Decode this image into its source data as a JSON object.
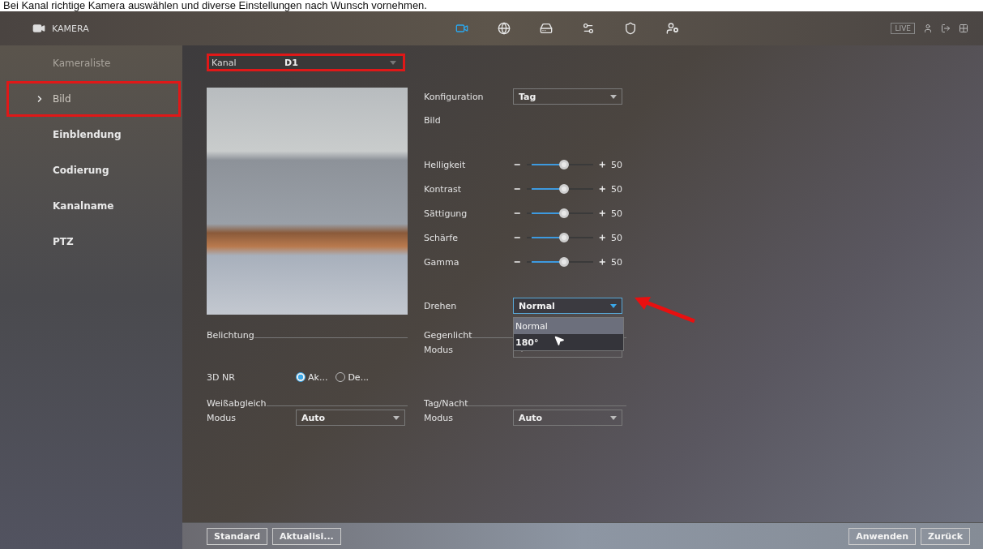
{
  "caption": "Bei Kanal richtige Kamera auswählen und diverse Einstellungen nach Wunsch vornehmen.",
  "topbar": {
    "title": "KAMERA",
    "live": "LIVE",
    "nav": [
      {
        "kind": "camera",
        "selected": true
      },
      {
        "kind": "network",
        "selected": false
      },
      {
        "kind": "storage",
        "selected": false
      },
      {
        "kind": "system",
        "selected": false
      },
      {
        "kind": "security",
        "selected": false
      },
      {
        "kind": "account",
        "selected": false
      }
    ]
  },
  "sidebar": {
    "items": [
      {
        "label": "Kameraliste",
        "kind": "heading",
        "selected": false,
        "highlighted": false
      },
      {
        "label": "Bild",
        "kind": "item",
        "selected": true,
        "highlighted": true
      },
      {
        "label": "Einblendung",
        "kind": "item",
        "selected": false,
        "highlighted": false
      },
      {
        "label": "Codierung",
        "kind": "item",
        "selected": false,
        "highlighted": false
      },
      {
        "label": "Kanalname",
        "kind": "item",
        "selected": false,
        "highlighted": false
      },
      {
        "label": "PTZ",
        "kind": "item",
        "selected": false,
        "highlighted": false
      }
    ]
  },
  "channel": {
    "label": "Kanal",
    "value": "D1",
    "highlighted": true
  },
  "config": {
    "label": "Konfiguration",
    "value": "Tag"
  },
  "image_heading": "Bild",
  "sliders": [
    {
      "label": "Helligkeit",
      "level": 0.5,
      "reading": "50"
    },
    {
      "label": "Kontrast",
      "level": 0.5,
      "reading": "50"
    },
    {
      "label": "Sättigung",
      "level": 0.5,
      "reading": "50"
    },
    {
      "label": "Schärfe",
      "level": 0.5,
      "reading": "50"
    },
    {
      "label": "Gamma",
      "level": 0.5,
      "reading": "50"
    }
  ],
  "rotate": {
    "label": "Drehen",
    "value": "Normal",
    "expanded": true,
    "options": [
      {
        "label": "Normal",
        "selected": true
      },
      {
        "label": "180°",
        "selected": false
      }
    ]
  },
  "exposure": {
    "heading": "Belichtung"
  },
  "backlight": {
    "heading": "Gegenlicht",
    "mode_label": "Modus"
  },
  "nr": {
    "label": "3D NR",
    "options": [
      {
        "label": "Ak...",
        "selected": true
      },
      {
        "label": "De...",
        "selected": false
      }
    ]
  },
  "white_balance": {
    "heading": "Weißabgleich",
    "mode_label": "Modus",
    "value": "Auto"
  },
  "day_night": {
    "heading": "Tag/Nacht",
    "mode_label": "Modus",
    "value": "Auto"
  },
  "footer": {
    "left_buttons": [
      "Standard",
      "Aktualisi..."
    ],
    "right_buttons": [
      "Anwenden",
      "Zurück"
    ]
  }
}
